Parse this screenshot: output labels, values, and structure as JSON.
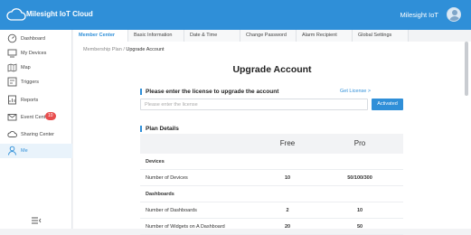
{
  "topbar": {
    "brand": "Milesight IoT Cloud",
    "user": "Milesight IoT"
  },
  "sidebar": {
    "items": [
      {
        "label": "Dashboard"
      },
      {
        "label": "My Devices"
      },
      {
        "label": "Map"
      },
      {
        "label": "Triggers"
      },
      {
        "label": "Reports"
      },
      {
        "label": "Event Center",
        "badge": "10"
      },
      {
        "label": "Sharing Center"
      },
      {
        "label": "Me"
      }
    ]
  },
  "tabs": [
    {
      "label": "Member Center"
    },
    {
      "label": "Basic Information"
    },
    {
      "label": "Date & Time"
    },
    {
      "label": "Change Password"
    },
    {
      "label": "Alarm Recipient"
    },
    {
      "label": "Global Settings"
    }
  ],
  "breadcrumb": {
    "parent": "Membership Plan",
    "sep": "/",
    "current": "Upgrade Account"
  },
  "main": {
    "title": "Upgrade Account",
    "license_section": "Please enter the license to upgrade the account",
    "get_license": "Get License >",
    "license_placeholder": "Please enter the license",
    "activate_label": "Activated",
    "plan_section": "Plan Details"
  },
  "plan_table": {
    "columns": [
      "",
      "Free",
      "Pro"
    ],
    "rows": [
      {
        "type": "group",
        "cells": [
          "Devices",
          "",
          ""
        ]
      },
      {
        "type": "data",
        "cells": [
          "Number of Devices",
          "10",
          "50/100/300"
        ]
      },
      {
        "type": "group",
        "cells": [
          "Dashboards",
          "",
          ""
        ]
      },
      {
        "type": "data",
        "cells": [
          "Number of Dashboards",
          "2",
          "10"
        ]
      },
      {
        "type": "data",
        "cells": [
          "Number of Widgets on A Dashboard",
          "20",
          "50"
        ]
      }
    ]
  },
  "colors": {
    "accent": "#2f8fd8",
    "badge": "#e84e4e"
  }
}
